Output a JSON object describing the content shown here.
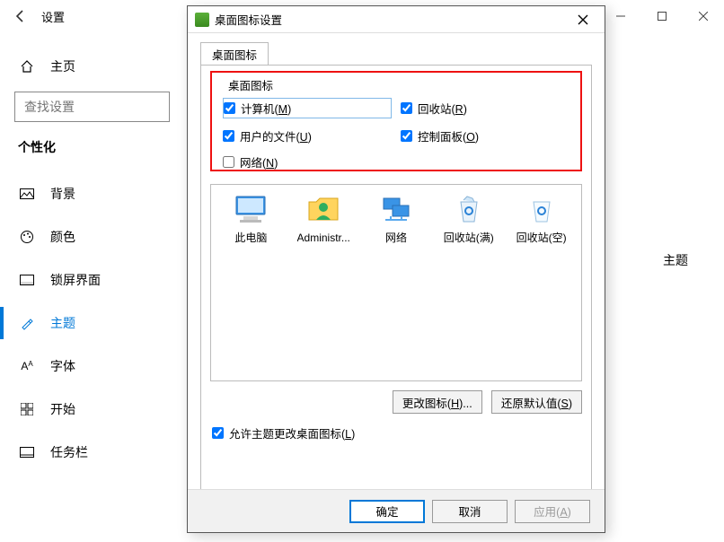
{
  "bg": {
    "title": "设置",
    "home": "主页",
    "search_placeholder": "查找设置",
    "section": "个性化",
    "items": [
      {
        "label": "背景"
      },
      {
        "label": "颜色"
      },
      {
        "label": "锁屏界面"
      },
      {
        "label": "主题"
      },
      {
        "label": "字体"
      },
      {
        "label": "开始"
      },
      {
        "label": "任务栏"
      }
    ],
    "content_fragment": "主题"
  },
  "dlg": {
    "title": "桌面图标设置",
    "tab": "桌面图标",
    "group_title": "桌面图标",
    "checkboxes": {
      "computer": {
        "label_pre": "计算机(",
        "u": "M",
        "label_post": ")",
        "checked": true,
        "focused": true
      },
      "recycle": {
        "label_pre": "回收站(",
        "u": "R",
        "label_post": ")",
        "checked": true
      },
      "userfiles": {
        "label_pre": "用户的文件(",
        "u": "U",
        "label_post": ")",
        "checked": true
      },
      "cpl": {
        "label_pre": "控制面板(",
        "u": "O",
        "label_post": ")",
        "checked": true
      },
      "network": {
        "label_pre": "网络(",
        "u": "N",
        "label_post": ")",
        "checked": false
      }
    },
    "preview": [
      {
        "label": "此电脑",
        "icon": "pc"
      },
      {
        "label": "Administr...",
        "icon": "user"
      },
      {
        "label": "网络",
        "icon": "net"
      },
      {
        "label": "回收站(满)",
        "icon": "bin-full"
      },
      {
        "label": "回收站(空)",
        "icon": "bin-empty"
      }
    ],
    "change_icon": {
      "pre": "更改图标(",
      "u": "H",
      "post": ")..."
    },
    "restore": {
      "pre": "还原默认值(",
      "u": "S",
      "post": ")"
    },
    "allow_themes": {
      "pre": "允许主题更改桌面图标(",
      "u": "L",
      "post": ")",
      "checked": true
    },
    "buttons": {
      "ok": "确定",
      "cancel": "取消",
      "apply_pre": "应用(",
      "apply_u": "A",
      "apply_post": ")"
    }
  }
}
